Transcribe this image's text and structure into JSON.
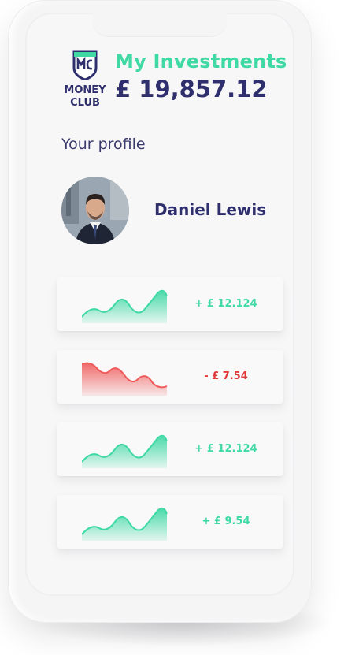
{
  "brand": {
    "logo_line1": "MONEY",
    "logo_line2": "CLUB",
    "logo_mark": "MC"
  },
  "header": {
    "title": "My Investments",
    "total_amount": "£ 19,857.12"
  },
  "profile": {
    "heading": "Your profile",
    "name": "Daniel Lewis"
  },
  "investments": [
    {
      "delta": "+ £ 12.124",
      "trend": "up",
      "color": "#3fd9a4"
    },
    {
      "delta": "- £ 7.54",
      "trend": "down",
      "color": "#e03a3a"
    },
    {
      "delta": "+ £ 12.124",
      "trend": "up",
      "color": "#3fd9a4"
    },
    {
      "delta": "+ £ 9.54",
      "trend": "up",
      "color": "#3fd9a4"
    }
  ],
  "colors": {
    "accent_green": "#3fd9a4",
    "accent_red": "#e03a3a",
    "brand_navy": "#2f2f6e"
  }
}
